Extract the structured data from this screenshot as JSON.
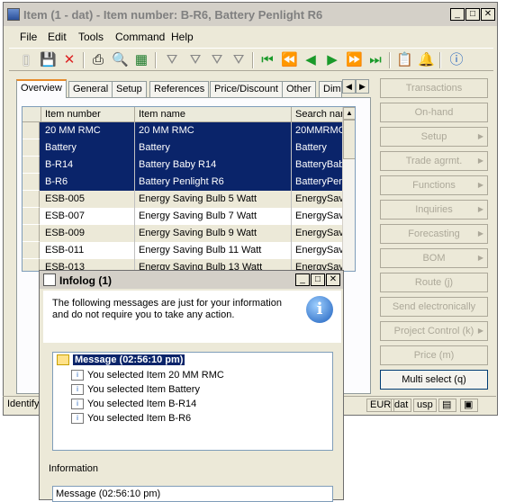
{
  "window": {
    "title": "Item (1 - dat) - Item number: B-R6, Battery Penlight R6",
    "controls": {
      "minimize": "_",
      "maximize": "□",
      "close": "✕"
    }
  },
  "menu": [
    "File",
    "Edit",
    "Tools",
    "Command",
    "Help"
  ],
  "toolbar_icons": [
    "new-icon",
    "save-icon",
    "delete-icon",
    "print-icon",
    "print-preview-icon",
    "excel-icon",
    "filter-icon",
    "filter-by-selection-icon",
    "advanced-filter-icon",
    "remove-filter-icon",
    "first-record-icon",
    "previous-page-icon",
    "previous-record-icon",
    "next-record-icon",
    "next-page-icon",
    "last-record-icon",
    "document-icon",
    "alert-icon",
    "help-icon"
  ],
  "tabs": [
    "Overview",
    "General",
    "Setup",
    "References",
    "Price/Discount",
    "Other",
    "Dim"
  ],
  "grid": {
    "columns": [
      "Item number",
      "Item name",
      "Search nar"
    ],
    "rows": [
      {
        "num": "20 MM RMC",
        "name": "20 MM RMC",
        "search": "20MMRMC",
        "state": "selected"
      },
      {
        "num": "Battery",
        "name": "Battery",
        "search": "Battery",
        "state": "selected"
      },
      {
        "num": "B-R14",
        "name": "Battery Baby R14",
        "search": "BatteryBab",
        "state": "selected"
      },
      {
        "num": "B-R6",
        "name": "Battery Penlight R6",
        "search": "BatteryPen",
        "state": "selected"
      },
      {
        "num": "ESB-005",
        "name": "Energy Saving Bulb 5 Watt",
        "search": "EnergySav",
        "state": "gray"
      },
      {
        "num": "ESB-007",
        "name": "Energy Saving Bulb 7 Watt",
        "search": "EnergySav",
        "state": "white"
      },
      {
        "num": "ESB-009",
        "name": "Energy Saving Bulb 9 Watt",
        "search": "EnergySav",
        "state": "gray"
      },
      {
        "num": "ESB-011",
        "name": "Energy Saving Bulb 11 Watt",
        "search": "EnergySav",
        "state": "white"
      },
      {
        "num": "ESB-013",
        "name": "Energy Saving Bulb 13 Watt",
        "search": "EnergySav",
        "state": "gray"
      }
    ]
  },
  "right_buttons": [
    {
      "label": "Transactions",
      "arrow": false,
      "enabled": false
    },
    {
      "label": "On-hand",
      "arrow": false,
      "enabled": false
    },
    {
      "label": "Setup",
      "arrow": true,
      "enabled": false
    },
    {
      "label": "Trade agrmt.",
      "arrow": true,
      "enabled": false
    },
    {
      "label": "Functions",
      "arrow": true,
      "enabled": false
    },
    {
      "label": "Inquiries",
      "arrow": true,
      "enabled": false
    },
    {
      "label": "Forecasting",
      "arrow": true,
      "enabled": false
    },
    {
      "label": "BOM",
      "arrow": true,
      "enabled": false
    },
    {
      "label": "Route (j)",
      "arrow": false,
      "enabled": false
    },
    {
      "label": "Send electronically",
      "arrow": false,
      "enabled": false
    },
    {
      "label": "Project Control (k)",
      "arrow": true,
      "enabled": false
    },
    {
      "label": "Price (m)",
      "arrow": false,
      "enabled": false
    },
    {
      "label": "Multi select (q)",
      "arrow": false,
      "enabled": true
    }
  ],
  "status": {
    "left": "Identify",
    "currency": "EUR",
    "company": "dat",
    "layer": "usp"
  },
  "infolog": {
    "title": "Infolog (1)",
    "message": "The following messages are just for your information and do not require you to take any action.",
    "root": "Message (02:56:10 pm)",
    "items": [
      "You selected Item 20 MM RMC",
      "You selected Item Battery",
      "You selected Item B-R14",
      "You selected Item B-R6"
    ],
    "info_label": "Information",
    "info_value": "Message (02:56:10 pm)"
  }
}
